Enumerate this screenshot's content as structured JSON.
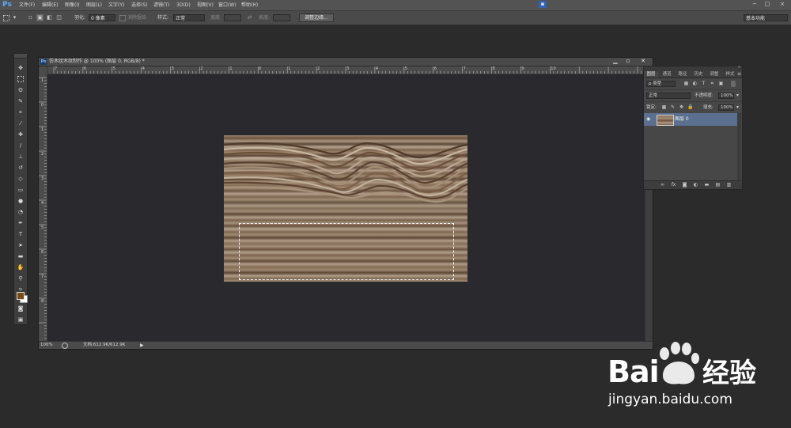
{
  "app": {
    "logo": "Ps",
    "accent": "#57a9ff"
  },
  "menubar": {
    "items": [
      "文件(F)",
      "编辑(E)",
      "图像(I)",
      "图层(L)",
      "文字(Y)",
      "选择(S)",
      "滤镜(T)",
      "3D(D)",
      "视图(V)",
      "窗口(W)",
      "帮助(H)"
    ],
    "window_controls": [
      "−",
      "□",
      "×"
    ]
  },
  "options": {
    "feather_label": "羽化:",
    "feather_value": "0 像素",
    "antialias_label": "消除锯齿",
    "style_label": "样式:",
    "style_value": "正常",
    "width_label": "宽度:",
    "height_label": "高度:",
    "refine_edge_button": "调整边缘...",
    "workspace": "基本功能"
  },
  "tools": {
    "icons": [
      "move-tool",
      "marquee-tool",
      "lasso-tool",
      "quick-select-tool",
      "crop-tool",
      "eyedropper-tool",
      "healing-brush-tool",
      "brush-tool",
      "clone-stamp-tool",
      "history-brush-tool",
      "eraser-tool",
      "gradient-tool",
      "blur-tool",
      "dodge-tool",
      "pen-tool",
      "type-tool",
      "path-select-tool",
      "shape-tool",
      "hand-tool",
      "zoom-tool"
    ],
    "foreground_color": "#7a4a16",
    "background_color": "#ffffff"
  },
  "document": {
    "title": "仿木纹木纹制作 @ 100% (图层 0, RGB/8) *",
    "zoom": "100%",
    "doc_info": "文档:612.9K/612.9K",
    "hruler_ticks": [
      "7",
      "6",
      "5",
      "4",
      "3",
      "2",
      "1",
      "0",
      "1",
      "2",
      "3",
      "4",
      "5",
      "6",
      "7",
      "8",
      "9",
      "10"
    ],
    "vruler_ticks": [
      "1",
      "0",
      "1",
      "2",
      "3",
      "4",
      "5",
      "6",
      "7",
      "8"
    ]
  },
  "layers_panel": {
    "tabs": [
      "图层",
      "通道",
      "路径",
      "历史",
      "调整",
      "样式"
    ],
    "kind_label": "ρ 类型",
    "blend_mode": "正常",
    "opacity_label": "不透明度:",
    "opacity_value": "100%",
    "lock_label": "锁定:",
    "fill_label": "填充:",
    "fill_value": "100%",
    "layer_name": "图层 0",
    "footer_icons": [
      "link-icon",
      "fx-icon",
      "mask-icon",
      "adjustment-icon",
      "group-icon",
      "new-layer-icon",
      "trash-icon"
    ]
  },
  "watermark": {
    "brand_left": "Bai",
    "brand_right": "经验",
    "url": "jingyan.baidu.com"
  }
}
